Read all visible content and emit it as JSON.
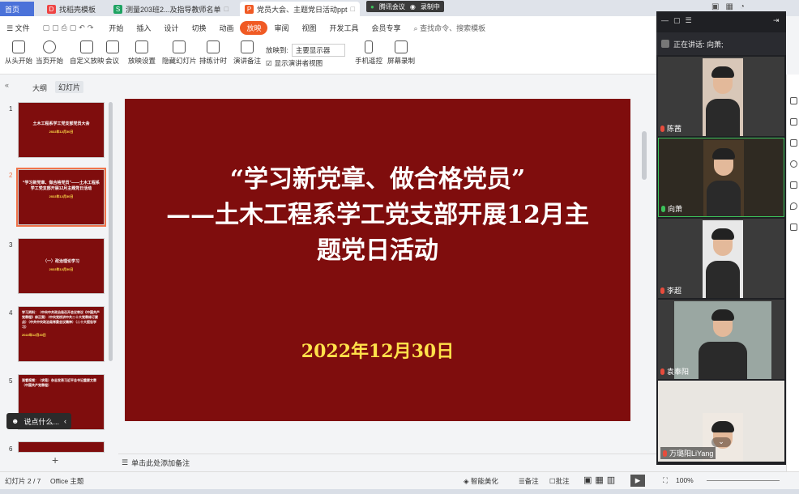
{
  "tabs": {
    "home": "首页",
    "t1": "找稻壳模板",
    "t2": "测量203班2...及指导教师名单",
    "t3": "党员大会、主题党日活动ppt",
    "meeting_badge": "腾讯会议",
    "recording": "录制中"
  },
  "menu": {
    "file": "文件",
    "items": [
      "开始",
      "插入",
      "设计",
      "切换",
      "动画",
      "放映",
      "审阅",
      "视图",
      "开发工具",
      "会员专享"
    ],
    "search": "查找命令、搜索模板"
  },
  "ribbon": {
    "from_start": "从头开始",
    "from_current": "当页开始",
    "custom": "自定义放映",
    "meeting": "会议",
    "settings": "放映设置",
    "hide_slide": "隐藏幻灯片",
    "timing": "排练计时",
    "notes": "演讲备注",
    "show_to_label": "放映到:",
    "show_to_value": "主要显示器",
    "presenter_view": "显示演讲者视图",
    "phone_remote": "手机遥控",
    "screen_record": "屏幕录制"
  },
  "panel": {
    "outline_tab": "大纲",
    "slides_tab": "幻灯片"
  },
  "thumbs": [
    {
      "num": "1",
      "title": "土木工程系学工党支部党员大会",
      "date": "2022年12月30日"
    },
    {
      "num": "2",
      "title": "“学习新党章、做合格党员”——土木工程系学工党支部开展12月主题党日活动",
      "date": "2022年12月30日"
    },
    {
      "num": "3",
      "title": "（一）政治理论学习",
      "date": "2022年12月30日"
    },
    {
      "num": "4",
      "title": "学习资料：（中央中共政治局召开会议审议《中国共产党章程》修正案）（中央党校讲中共二十大党章修订要点）（中共中央政治局常委会议精神）（二十大报告学习）",
      "date": "2022年12月30日"
    },
    {
      "num": "5",
      "title": "观看视频：（求是）杂志发表习近平总书记重要文章（中国共产党章程）",
      "date": ""
    },
    {
      "num": "6",
      "title": "",
      "date": ""
    }
  ],
  "slide": {
    "line1": "“学习新党章、做合格党员”",
    "line2": "——土木工程系学工党支部开展12月主",
    "line3": "题党日活动",
    "date": "2022年12月30日"
  },
  "chat_placeholder": "说点什么...",
  "notes_placeholder": "单击此处添加备注",
  "status": {
    "slide_counter": "幻灯片 2 / 7",
    "theme": "Office 主题",
    "beautify": "智能美化",
    "notes": "备注",
    "comments": "批注",
    "zoom": "100%"
  },
  "meeting": {
    "speaking_label": "正在讲话: 向萧;",
    "participants": [
      "陈茜",
      "向萧",
      "李超",
      "袁奉阳",
      "万璐阳LiYang"
    ]
  },
  "colors": {
    "slide_bg": "#7f0d0d",
    "slide_text": "#ffffff",
    "slide_date": "#ffe14a",
    "accent": "#f05a24"
  }
}
